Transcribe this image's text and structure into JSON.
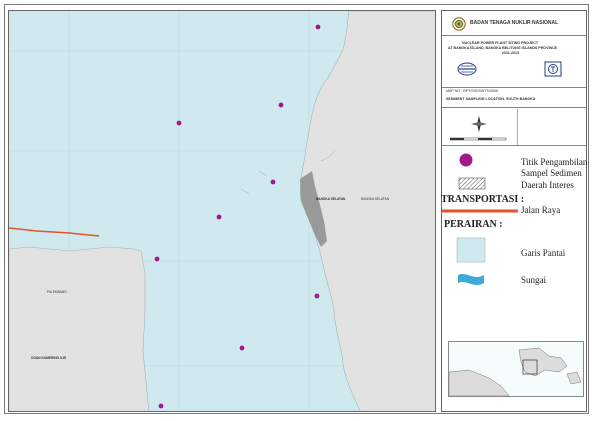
{
  "header": {
    "agency": "BADAN TENAGA NUKLIR NASIONAL",
    "project_line1": "NUCLEAR POWER PLANT SITING PROJECT",
    "project_line2": "AT BANGKA ISLAND, BANGKA BELITUNG ISLANDS PROVINCE",
    "project_years": "2011-2013",
    "map_no_label": "MAP NO : RPT/SIG/SWTS/0005",
    "map_title": "SEDIMENT SAMPLING LOCATION, SOUTH BANGKA"
  },
  "legend": {
    "sample_point_label": "Titik Pengambilan",
    "sample_point_label2": "Sampel Sedimen",
    "interest_area_label": "Daerah Interes",
    "transport_heading": "TRANSPORTASI :",
    "road_label": "Jalan Raya",
    "water_heading": "PERAIRAN :",
    "coastline_label": "Garis Pantai",
    "river_label": "Sungai"
  },
  "map_labels": {
    "south_bangka": "BANGKA SELATAN",
    "east_small": "BANGKA SELATAN",
    "west_small": "PALEMBANG",
    "west_district": "OGAN KOMERING ILIR"
  },
  "colors": {
    "sea": "#cfe9ef",
    "land": "#e2e2e2",
    "interest_area": "#9a9a9a",
    "sample_point": "#a01a8a",
    "road": "#e0552a",
    "river": "#3fa9d8"
  }
}
